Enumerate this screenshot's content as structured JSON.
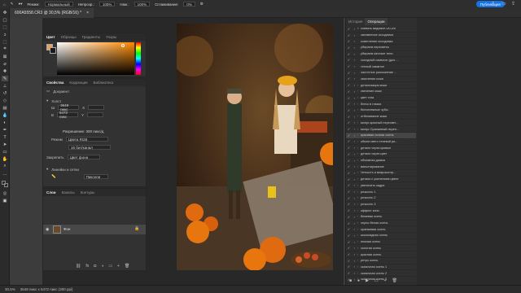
{
  "options_bar": {
    "mode_label": "Режим:",
    "mode_value": "Нормальный",
    "opacity_label": "Непрозр.:",
    "opacity_value": "100%",
    "flow_label": "Наж.:",
    "flow_value": "100%",
    "smoothing_label": "Сглаживание:",
    "smoothing_value": "0%",
    "publish_label": "Публикация"
  },
  "document": {
    "tab_title": "600A5558.CR3 @ 30,5% (RGB/16) *",
    "close_symbol": "×"
  },
  "color_panel": {
    "tabs": [
      "Цвет",
      "Образцы",
      "Градиенты",
      "Узоры"
    ],
    "fg_color": "#e8a25a",
    "bg_color": "#1b1b1b"
  },
  "properties_panel": {
    "tabs": [
      "Свойства",
      "Коррекция",
      "Библиотека"
    ],
    "doc_label": "Документ",
    "canvas_section": "Холст",
    "width_label": "Ш",
    "width_value": "3648 пикс",
    "height_label": "В",
    "height_value": "5472 пикс",
    "x_label": "X",
    "y_label": "Y",
    "resolution_text": "Разрешение: 300 пикс/д",
    "mode_label": "Режим",
    "mode_value": "Цвета RGB",
    "depth_value": "16 бит/канал",
    "fill_label": "Закрепить",
    "fill_value": "Цвет фона",
    "rulers_section": "Линейки и сетки",
    "units_value": "Пиксели"
  },
  "layers_panel": {
    "tabs": [
      "Слои",
      "Каналы",
      "Контуры"
    ],
    "layer_name": "Фон"
  },
  "history_panel": {
    "tabs": [
      "История",
      "Операции"
    ],
    "items": [
      {
        "label": "сливать видимое u/u,o/o",
        "arrow": "▾"
      },
      {
        "label": "затемнение исходника",
        "arrow": ""
      },
      {
        "label": "осветление исходника",
        "arrow": ""
      },
      {
        "label": "убираем пересветы",
        "arrow": ""
      },
      {
        "label": "убираем жесткие тени",
        "arrow": ""
      },
      {
        "label": "холодный саммтон (для ...",
        "arrow": ""
      },
      {
        "label": "теплый саммтон",
        "arrow": ""
      },
      {
        "label": "частотное разложение ...",
        "arrow": ""
      },
      {
        "label": "смягчение кожи",
        "arrow": ""
      },
      {
        "label": "детализация кожи",
        "arrow": "›"
      },
      {
        "label": "свечение кожи",
        "arrow": "›"
      },
      {
        "label": "цвет глаз",
        "arrow": "›"
      },
      {
        "label": "блеск в глазах",
        "arrow": "›"
      },
      {
        "label": "белоснежные зубы",
        "arrow": "›"
      },
      {
        "label": "отбеливание кожи",
        "arrow": "›"
      },
      {
        "label": "минус красный пересвет...",
        "arrow": "›"
      },
      {
        "label": "минус Оранжевый переп...",
        "arrow": "›"
      },
      {
        "label": "красивая сочная осень",
        "arrow": "›"
      },
      {
        "label": "обьем свето теневой ри...",
        "arrow": "›"
      },
      {
        "label": "детали через кривые",
        "arrow": "›"
      },
      {
        "label": "детали через цвет",
        "arrow": "›"
      },
      {
        "label": "объемная дымка",
        "arrow": "›"
      },
      {
        "label": "виньетирование",
        "arrow": "›"
      },
      {
        "label": "Четкость и микроконтр...",
        "arrow": "›"
      },
      {
        "label": "детали с усилением цвете",
        "arrow": "›"
      },
      {
        "label": "увеличить кадра",
        "arrow": "›"
      },
      {
        "label": "резкость 1",
        "arrow": "›"
      },
      {
        "label": "резкость 2",
        "arrow": "›"
      },
      {
        "label": "резкость 3",
        "arrow": "›"
      },
      {
        "label": "эффект кино",
        "arrow": "›"
      },
      {
        "label": "бежевая осень",
        "arrow": "›"
      },
      {
        "label": "черно-белая осень",
        "arrow": "›"
      },
      {
        "label": "оранжевая осень",
        "arrow": "›"
      },
      {
        "label": "шоколадная осень",
        "arrow": "›"
      },
      {
        "label": "нежная осень",
        "arrow": "›"
      },
      {
        "label": "золотая осень",
        "arrow": "›"
      },
      {
        "label": "красная осень",
        "arrow": "›"
      },
      {
        "label": "ретро осень",
        "arrow": "›"
      },
      {
        "label": "сказочная осень 1",
        "arrow": "›"
      },
      {
        "label": "сказочная осень 2",
        "arrow": "›"
      },
      {
        "label": "сказочная осень 3",
        "arrow": "›"
      }
    ],
    "selected_index": 17
  },
  "status_bar": {
    "zoom": "30,5%",
    "info": "3648 пикс x 5472 пикс (300 ppi)"
  },
  "colors": {
    "accent": "#1473e6",
    "photo_bg": "#3a2a1a"
  }
}
